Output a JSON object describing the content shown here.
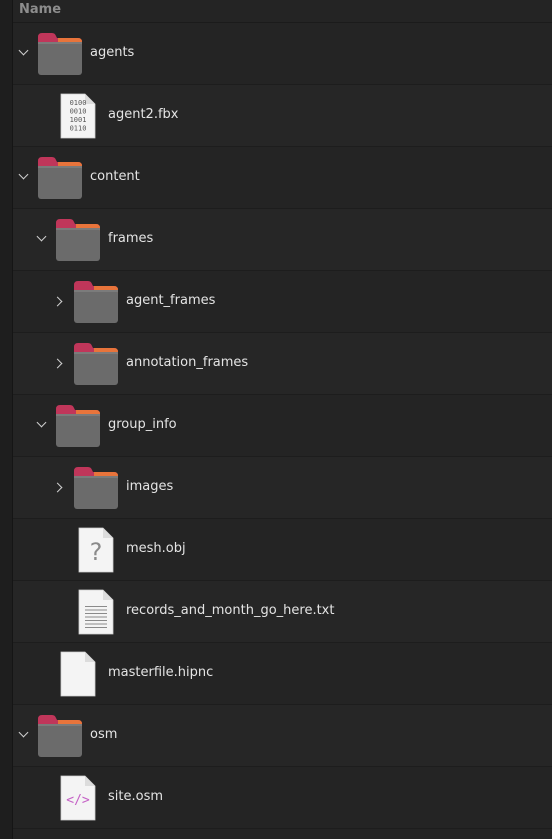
{
  "header": {
    "name_label": "Name"
  },
  "rows": [
    {
      "label": "agents",
      "type": "folder",
      "depth": 0,
      "expander": "expanded",
      "icon": "folder-icon"
    },
    {
      "label": "agent2.fbx",
      "type": "binary-file",
      "depth": 1,
      "expander": "none",
      "icon": "binary-file-icon"
    },
    {
      "label": "content",
      "type": "folder",
      "depth": 0,
      "expander": "expanded",
      "icon": "folder-icon"
    },
    {
      "label": "frames",
      "type": "folder",
      "depth": 1,
      "expander": "expanded",
      "icon": "folder-icon"
    },
    {
      "label": "agent_frames",
      "type": "folder",
      "depth": 2,
      "expander": "collapsed",
      "icon": "folder-icon"
    },
    {
      "label": "annotation_frames",
      "type": "folder",
      "depth": 2,
      "expander": "collapsed",
      "icon": "folder-icon"
    },
    {
      "label": "group_info",
      "type": "folder",
      "depth": 1,
      "expander": "expanded",
      "icon": "folder-icon"
    },
    {
      "label": "images",
      "type": "folder",
      "depth": 2,
      "expander": "collapsed",
      "icon": "folder-icon"
    },
    {
      "label": "mesh.obj",
      "type": "unknown-file",
      "depth": 2,
      "expander": "none",
      "icon": "unknown-file-icon"
    },
    {
      "label": "records_and_month_go_here.txt",
      "type": "text-file",
      "depth": 2,
      "expander": "none",
      "icon": "text-file-icon"
    },
    {
      "label": "masterfile.hipnc",
      "type": "blank-file",
      "depth": 1,
      "expander": "none",
      "icon": "blank-file-icon"
    },
    {
      "label": "osm",
      "type": "folder",
      "depth": 0,
      "expander": "expanded",
      "icon": "folder-icon"
    },
    {
      "label": "site.osm",
      "type": "xml-file",
      "depth": 1,
      "expander": "none",
      "icon": "xml-file-icon"
    }
  ],
  "colors": {
    "background": "#242424",
    "folder_tab": "#c0365a",
    "folder_tab_right": "#e8743b",
    "folder_body": "#6b6b6b",
    "text": "#e4e4e4",
    "header_text": "#8d8d8d",
    "xml_glyph": "#c561c6"
  },
  "binary_glyph_lines": [
    "0100",
    "0010",
    "1001",
    "0110"
  ],
  "unknown_glyph": "?",
  "xml_glyph": "</>"
}
